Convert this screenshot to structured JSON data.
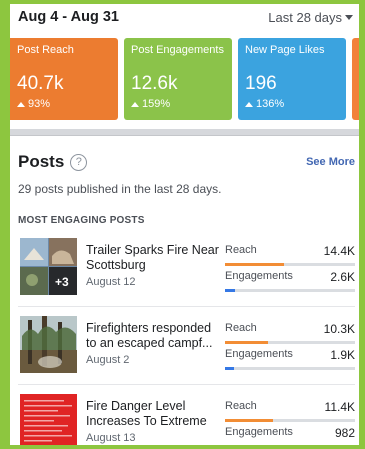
{
  "header": {
    "date_range": "Aug 4 - Aug 31",
    "period_label": "Last 28 days"
  },
  "colors": {
    "reach": "#ec7c30",
    "engagement": "#8bc34a",
    "likes": "#3ba3df",
    "reach_bar": "#f28d35",
    "engagement_bar": "#3578e5"
  },
  "cards": [
    {
      "label": "Post Reach",
      "value": "40.7k",
      "change": "93%",
      "color": "#ec7c30"
    },
    {
      "label": "Post Engagements",
      "value": "12.6k",
      "change": "159%",
      "color": "#8bc34a"
    },
    {
      "label": "New Page Likes",
      "value": "196",
      "change": "136%",
      "color": "#3ba3df"
    }
  ],
  "posts_section": {
    "title": "Posts",
    "see_more": "See More",
    "subtitle": "29 posts published in the last 28 days.",
    "list_label": "MOST ENGAGING POSTS",
    "reach_label": "Reach",
    "engagements_label": "Engagements"
  },
  "posts": [
    {
      "title": "Trailer Sparks Fire Near Scottsburg",
      "date": "August 12",
      "reach": "14.4K",
      "engagements": "2.6K",
      "reach_ratio": 0.45,
      "engagement_ratio": 0.08,
      "photo_count": "+3"
    },
    {
      "title": "Firefighters responded to an escaped campf...",
      "date": "August 2",
      "reach": "10.3K",
      "engagements": "1.9K",
      "reach_ratio": 0.33,
      "engagement_ratio": 0.07
    },
    {
      "title": "Fire Danger Level Increases To Extreme",
      "date": "August 13",
      "reach": "11.4K",
      "engagements": "982",
      "reach_ratio": 0.37,
      "engagement_ratio": 0.04
    }
  ]
}
